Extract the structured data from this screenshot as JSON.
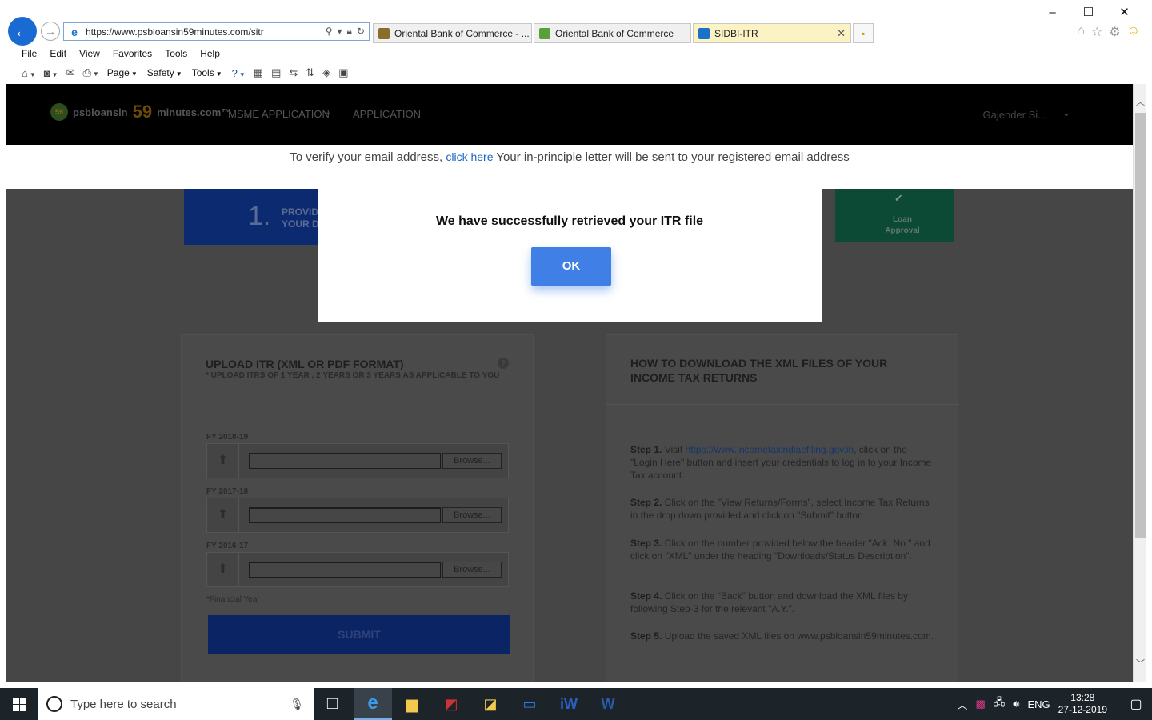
{
  "browser": {
    "url": "https://www.psbloansin59minutes.com/sitr",
    "tabs": [
      {
        "title": "Oriental Bank of Commerce - ...",
        "icon_color": "#8a6d2b"
      },
      {
        "title": "Oriental Bank of Commerce",
        "icon_color": "#5aa03a"
      },
      {
        "title": "SIDBI-ITR",
        "icon_color": "#1a73c9",
        "close": "✕"
      }
    ],
    "menu": [
      "File",
      "Edit",
      "View",
      "Favorites",
      "Tools",
      "Help"
    ],
    "commands": {
      "page": "Page",
      "safety": "Safety",
      "tools": "Tools"
    }
  },
  "site": {
    "logo_text": "psbloansin",
    "logo_59": "59",
    "logo_suffix": "minutes.com™",
    "nav": [
      "MSME APPLICATION",
      "APPLICATION"
    ],
    "user": "Gajender Si...",
    "verify_prefix": "To verify your email address,",
    "verify_link": "click here",
    "verify_suffix": "Your in-principle letter will be sent to your registered email address",
    "step1_num": "1.",
    "step1_text": "PROVID\nYOUR D",
    "step_final_text": "Loan\nApproval"
  },
  "upload": {
    "title": "UPLOAD ITR (XML OR PDF FORMAT)",
    "subtitle": "* UPLOAD ITRS OF 1 YEAR , 2 YEARS OR 3 YEARS AS APPLICABLE TO YOU",
    "help": "?",
    "rows": [
      {
        "fy": "FY 2018-19",
        "browse": "Browse..."
      },
      {
        "fy": "FY 2017-18",
        "browse": "Browse..."
      },
      {
        "fy": "FY 2016-17",
        "browse": "Browse..."
      }
    ],
    "footnote": "*Financial Year",
    "submit": "SUBMIT"
  },
  "howto": {
    "title": "HOW TO DOWNLOAD THE XML FILES OF YOUR INCOME TAX RETURNS",
    "steps": [
      {
        "label": "Step 1.",
        "pre": "Visit",
        "link": "https://www.incometaxindiaefiling.gov.in",
        "text": ", click on the \"Login Here\" button and insert your credentials to log in to your Income Tax account."
      },
      {
        "label": "Step 2.",
        "text": "Click on the \"View Returns/Forms\", select Income Tax Returns in the drop down provided and click on \"Submit\" button."
      },
      {
        "label": "Step 3.",
        "text": "Click on the number provided below the header \"Ack. No.\" and click on \"XML\" under the heading \"Downloads/Status Description\"."
      },
      {
        "label": "Step 4.",
        "text": "Click on the \"Back\" button and download the XML files by following Step-3 for the relevant \"A.Y.\"."
      },
      {
        "label": "Step 5.",
        "text": "Upload the saved XML files on www.psbloansin59minutes.com."
      }
    ]
  },
  "dialog": {
    "message": "We have successfully retrieved your ITR file",
    "ok": "OK"
  },
  "taskbar": {
    "search_placeholder": "Type here to search",
    "lang": "ENG",
    "time": "13:28",
    "date": "27-12-2019"
  }
}
